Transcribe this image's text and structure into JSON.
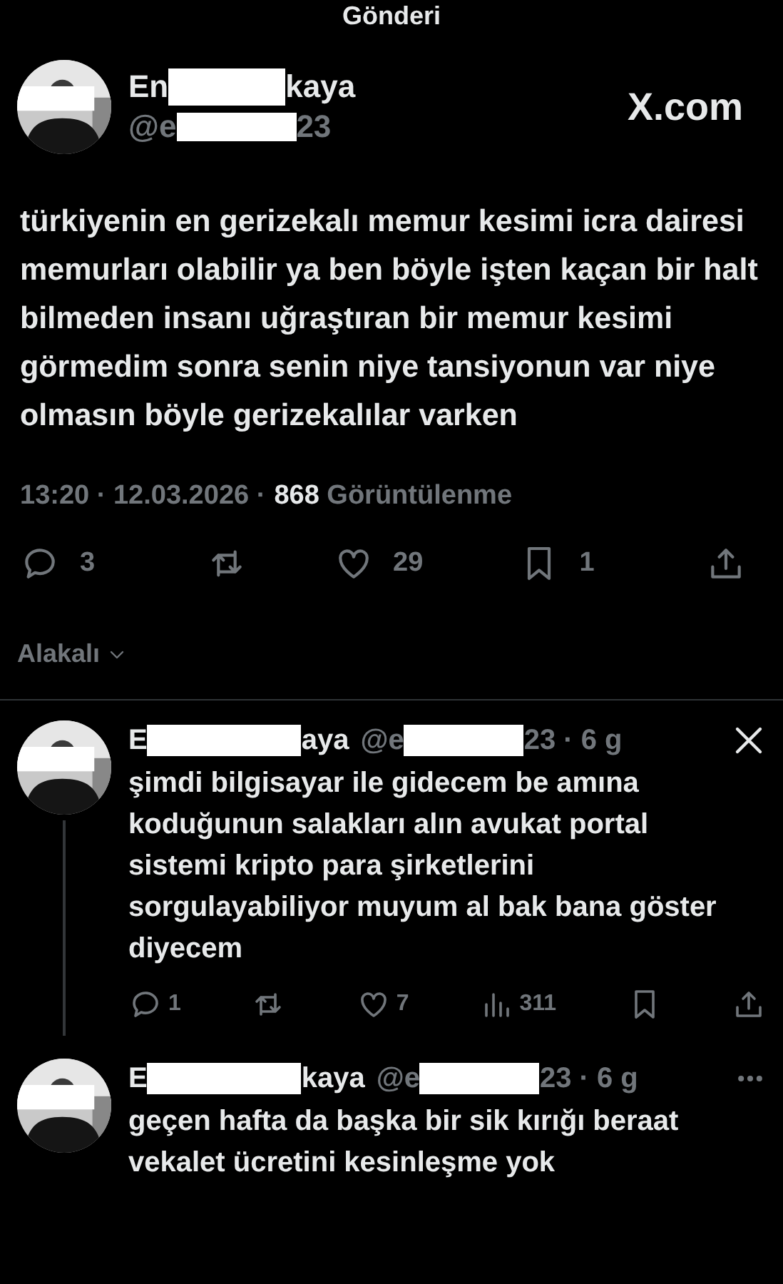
{
  "header": {
    "title": "Gönderi"
  },
  "post": {
    "name_start": "En",
    "name_end": "kaya",
    "handle_start": "@e",
    "handle_end": "23",
    "brand": "X.com",
    "text": "türkiyenin en gerizekalı memur kesimi icra dairesi memurları olabilir ya ben böyle işten kaçan bir halt bilmeden insanı uğraştıran bir memur kesimi görmedim sonra senin niye tansiyonun var niye olmasın böyle gerizekalılar varken",
    "time": "13:20 · 12.03.2026 ·",
    "views": "868",
    "views_label": "Görüntülenme",
    "actions": [
      {
        "kind": "reply",
        "count": "3"
      },
      {
        "kind": "repost"
      },
      {
        "kind": "like",
        "count": "29"
      },
      {
        "kind": "bookmark",
        "count": "1"
      },
      {
        "kind": "share"
      }
    ]
  },
  "sort": {
    "label": "Alakalı"
  },
  "replies": [
    {
      "name_start": "E",
      "name_end": "aya",
      "handle_start": "@e",
      "handle_end": "23 · 6 g",
      "x_logo": true,
      "more_button": false,
      "thread_line": true,
      "text": "şimdi bilgisayar ile gidecem be amına koduğunun salakları alın avukat portal sistemi kripto para şirketlerini sorgulayabiliyor muyum al bak bana göster diyecem",
      "actions": [
        {
          "kind": "reply",
          "count": "1"
        },
        {
          "kind": "repost"
        },
        {
          "kind": "like",
          "count": "7"
        },
        {
          "kind": "views",
          "count": "311"
        },
        {
          "kind": "bookmark"
        },
        {
          "kind": "share"
        }
      ]
    },
    {
      "name_start": "E",
      "name_end": "kaya",
      "handle_start": "@e",
      "handle_end": "23 · 6 g",
      "x_logo": false,
      "more_button": true,
      "thread_line": false,
      "text": "geçen hafta da başka bir sik kırığı beraat vekalet ücretini kesinleşme yok"
    }
  ]
}
